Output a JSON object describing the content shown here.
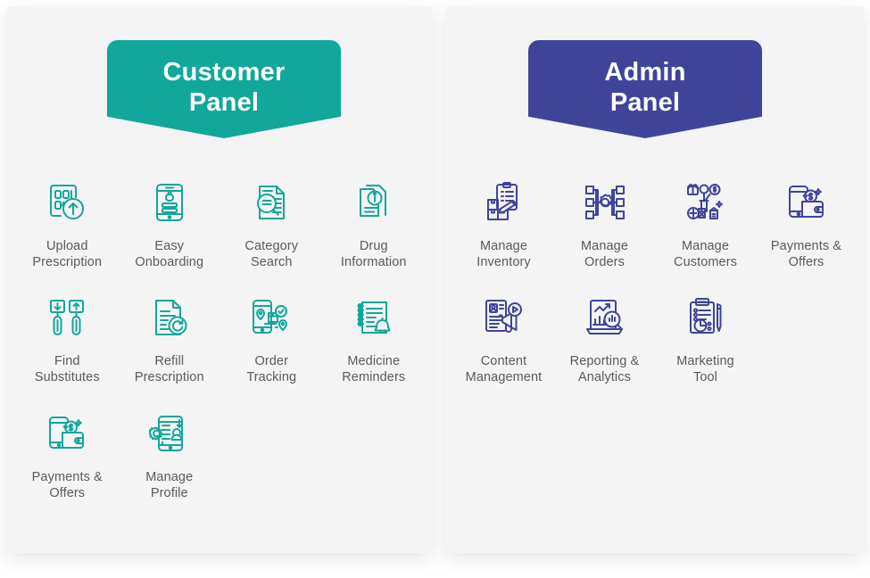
{
  "colors": {
    "page_background": "#ffffff",
    "card_background": "#f4f4f4",
    "customer_accent": "#11a79b",
    "admin_accent": "#3f449b",
    "label_text": "#5a5a5a",
    "banner_text": "#ffffff"
  },
  "panels": [
    {
      "id": "customer",
      "banner_line1": "Customer",
      "banner_line2": "Panel",
      "accent": "#11a79b",
      "features": [
        {
          "label": "Upload\nPrescription",
          "icon": "upload-prescription-icon"
        },
        {
          "label": "Easy\nOnboarding",
          "icon": "easy-onboarding-icon"
        },
        {
          "label": "Category\nSearch",
          "icon": "category-search-icon"
        },
        {
          "label": "Drug\nInformation",
          "icon": "drug-information-icon"
        },
        {
          "label": "Find\nSubstitutes",
          "icon": "find-substitutes-icon"
        },
        {
          "label": "Refill\nPrescription",
          "icon": "refill-prescription-icon"
        },
        {
          "label": "Order\nTracking",
          "icon": "order-tracking-icon"
        },
        {
          "label": "Medicine\nReminders",
          "icon": "medicine-reminders-icon"
        },
        {
          "label": "Payments &\nOffers",
          "icon": "payments-offers-icon"
        },
        {
          "label": "Manage\nProfile",
          "icon": "manage-profile-icon"
        }
      ]
    },
    {
      "id": "admin",
      "banner_line1": "Admin",
      "banner_line2": "Panel",
      "accent": "#3f449b",
      "features": [
        {
          "label": "Manage\nInventory",
          "icon": "manage-inventory-icon"
        },
        {
          "label": "Manage\nOrders",
          "icon": "manage-orders-icon"
        },
        {
          "label": "Manage\nCustomers",
          "icon": "manage-customers-icon"
        },
        {
          "label": "Payments &\nOffers",
          "icon": "payments-offers-icon"
        },
        {
          "label": "Content\nManagement",
          "icon": "content-management-icon"
        },
        {
          "label": "Reporting &\nAnalytics",
          "icon": "reporting-analytics-icon"
        },
        {
          "label": "Marketing\nTool",
          "icon": "marketing-tool-icon"
        }
      ]
    }
  ]
}
